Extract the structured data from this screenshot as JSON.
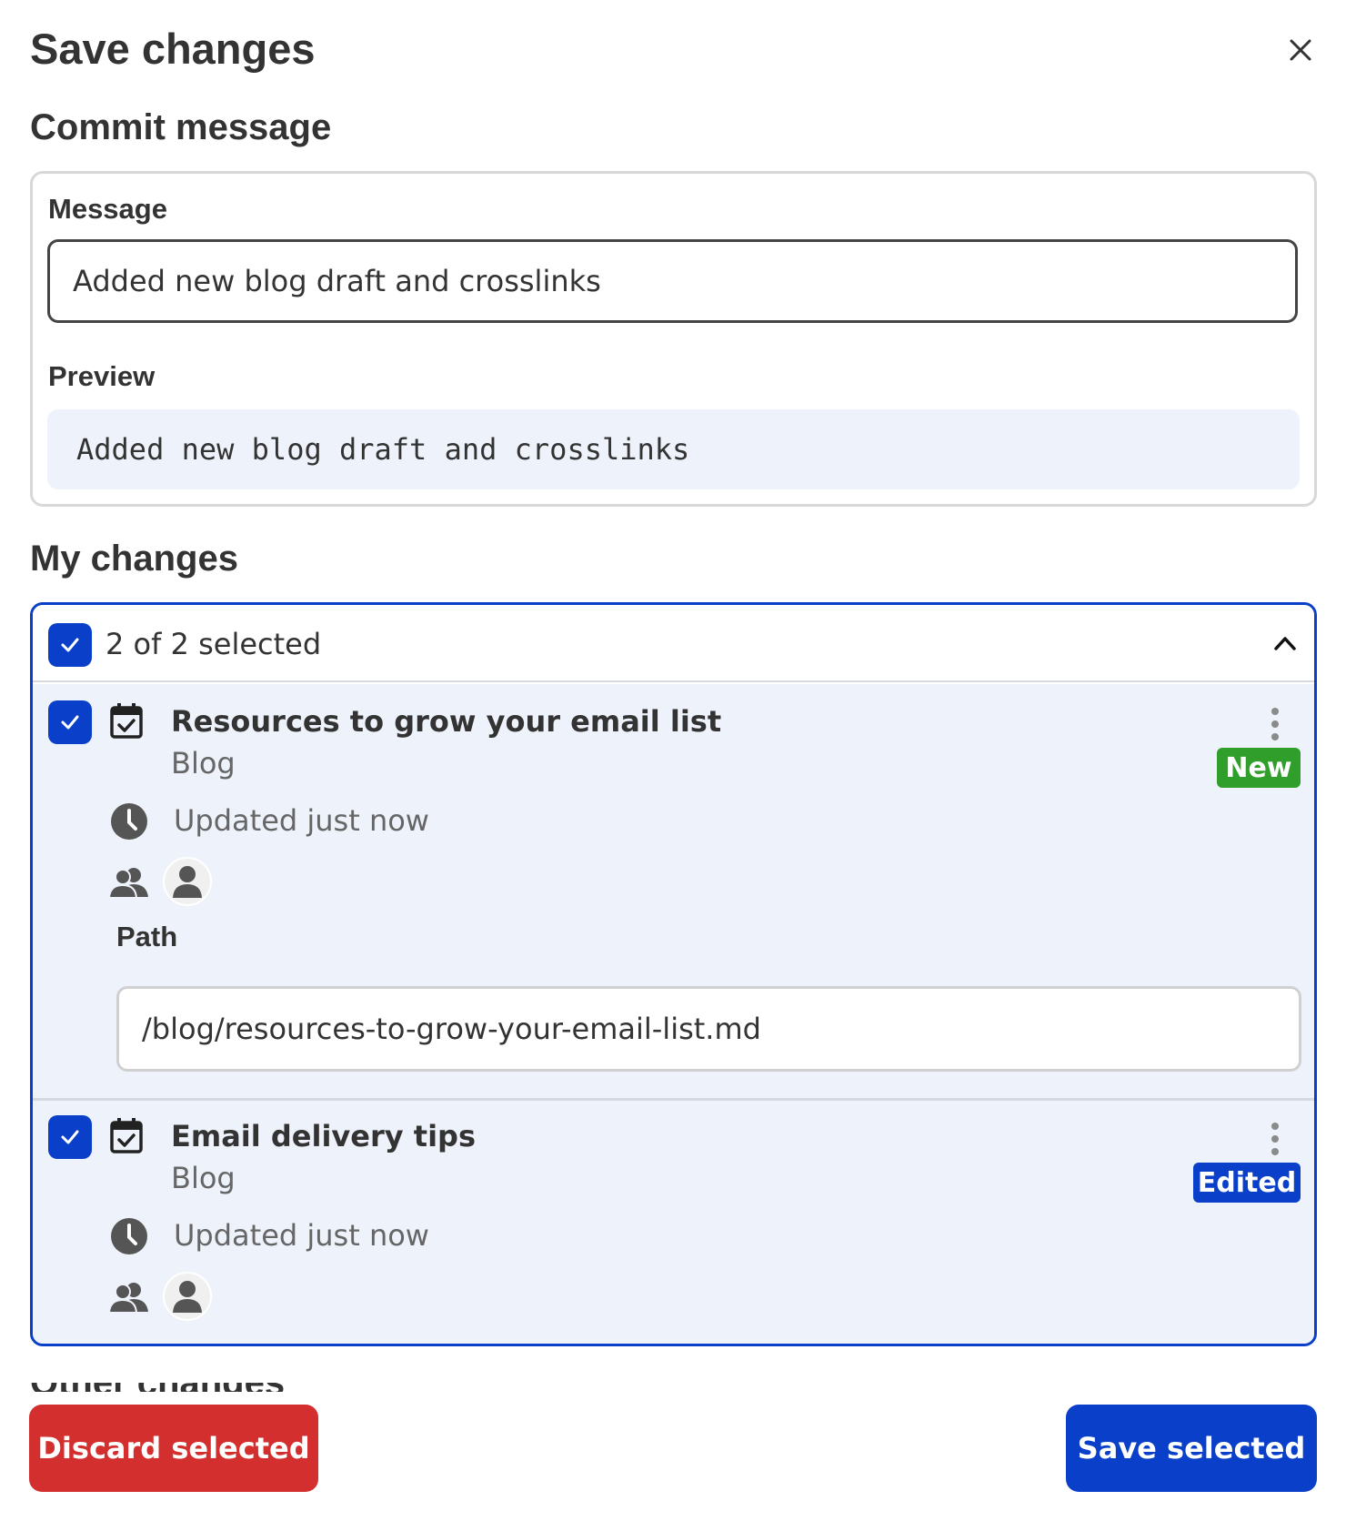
{
  "dialog": {
    "title": "Save changes",
    "close_icon": "close-icon"
  },
  "commit": {
    "heading": "Commit message",
    "message_label": "Message",
    "message_value": "Added new blog draft and crosslinks",
    "preview_label": "Preview",
    "preview_text": "Added new blog draft and crosslinks"
  },
  "changes": {
    "heading": "My changes",
    "selection_text": "2 of 2 selected",
    "items": [
      {
        "title": "Resources to grow your email list",
        "type": "Blog",
        "updated": "Updated just now",
        "badge": "New",
        "path_label": "Path",
        "path_value": "/blog/resources-to-grow-your-email-list.md"
      },
      {
        "title": "Email delivery tips",
        "type": "Blog",
        "updated": "Updated just now",
        "badge": "Edited"
      }
    ]
  },
  "other": {
    "heading": "Other changes"
  },
  "footer": {
    "discard_label": "Discard selected",
    "save_label": "Save selected"
  },
  "colors": {
    "primary": "#0a3fc9",
    "danger": "#d32f2f",
    "success": "#2f9e2a",
    "item_bg": "#eef2fb"
  }
}
